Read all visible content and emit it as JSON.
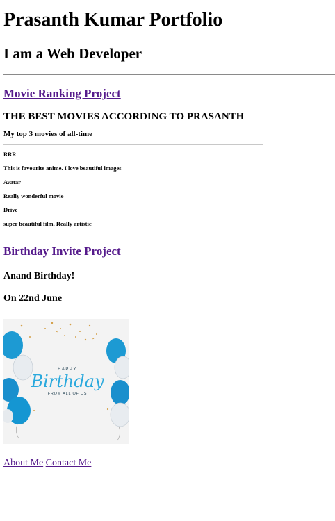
{
  "header": {
    "title": "Prasanth Kumar Portfolio",
    "tagline": "I am a Web Developer"
  },
  "projects": {
    "movie": {
      "link_label": "Movie Ranking Project",
      "preview": {
        "title": "THE BEST MOVIES ACCORDING TO PRASANTH",
        "subtitle": "My top 3 movies of all-time",
        "items": [
          {
            "name": "RRR",
            "note": "This is favourite anime. I love beautiful images"
          },
          {
            "name": "Avatar",
            "note": "Really wonderful movie"
          },
          {
            "name": "Drive",
            "note": "super beautiful film. Really artistic"
          }
        ]
      }
    },
    "birthday": {
      "link_label": "Birthday Invite Project",
      "heading": "Anand Birthday!",
      "date": "On 22nd June",
      "card": {
        "line1": "HAPPY",
        "line2": "Birthday",
        "line3": "FROM ALL OF US",
        "accent": "#2aa9dd",
        "confetti": "#d4a04a"
      }
    }
  },
  "footer": {
    "about_label": "About Me",
    "contact_label": "Contact Me"
  }
}
